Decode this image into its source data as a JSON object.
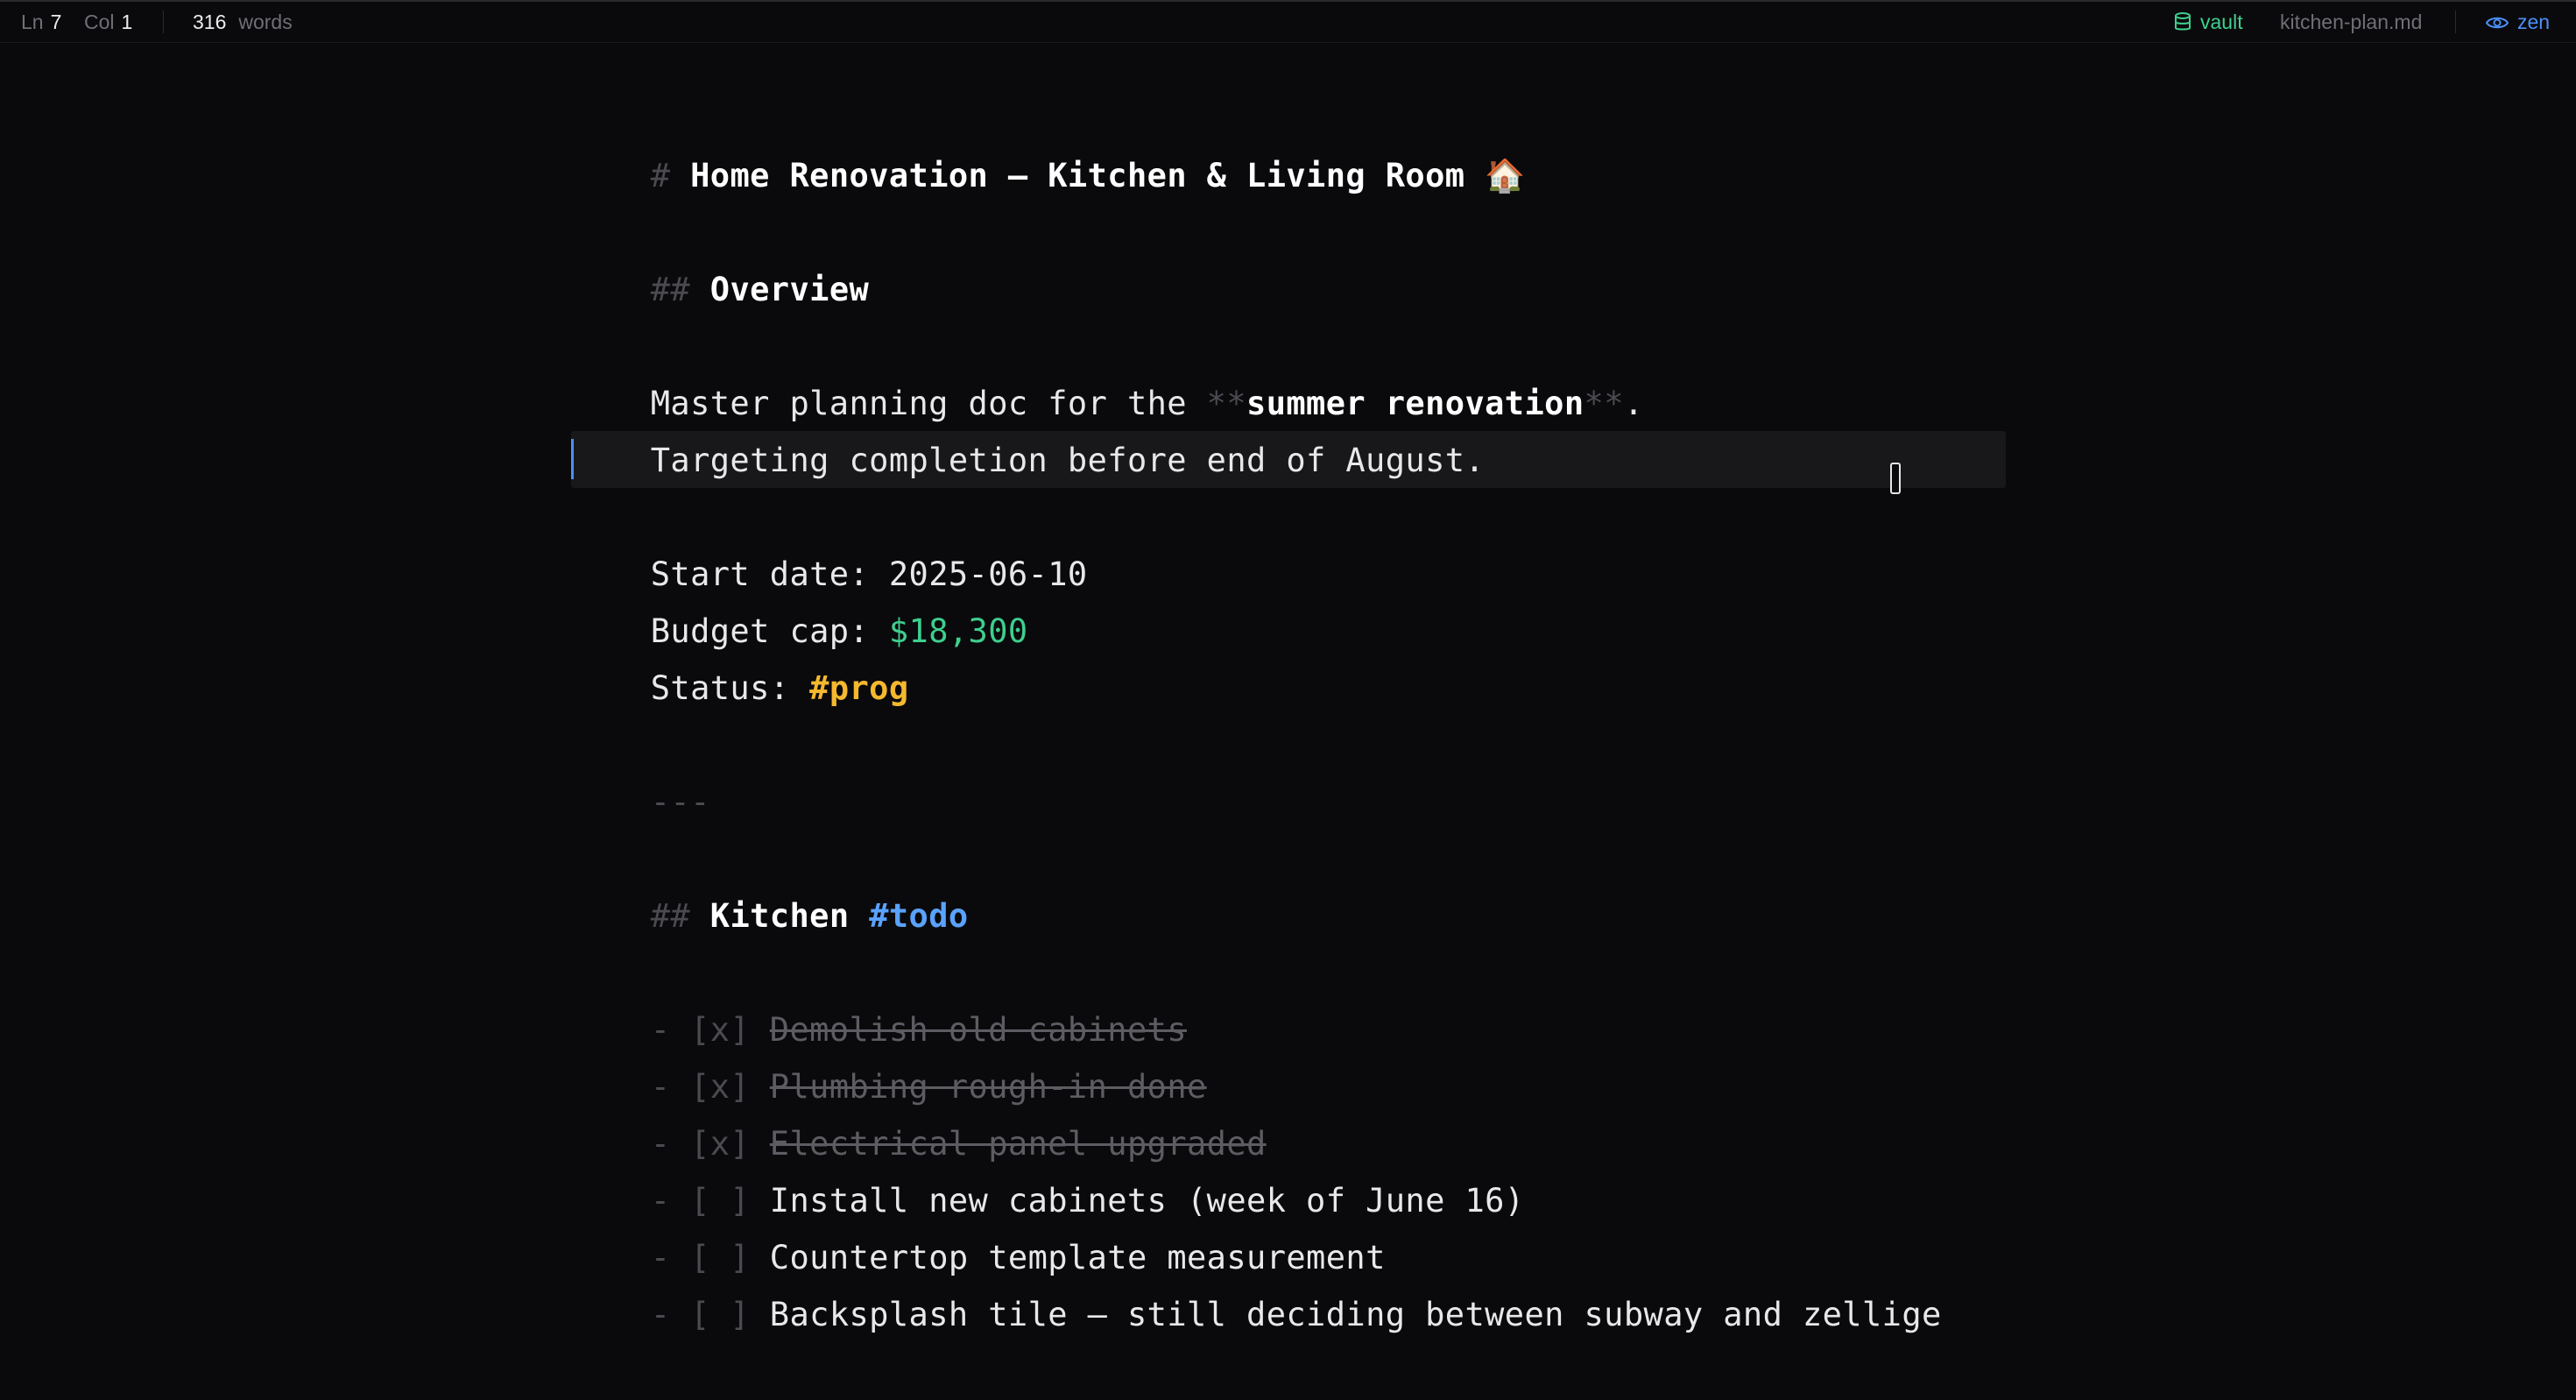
{
  "status_bar": {
    "ln_label": "Ln",
    "ln_value": "7",
    "col_label": "Col",
    "col_value": "1",
    "word_count": "316",
    "words_label": "words",
    "vault_label": "vault",
    "filename": "kitchen-plan.md",
    "zen_label": "zen"
  },
  "document": {
    "h1_marker": "#",
    "title": "Home Renovation — Kitchen & Living Room 🏠",
    "h2_marker": "##",
    "overview_heading": "Overview",
    "overview_text_before": "Master planning doc for the ",
    "bold_marker": "**",
    "overview_bold": "summer renovation",
    "overview_text_after": ".",
    "overview_line2": "Targeting completion before end of August.",
    "start_date_label": "Start date: ",
    "start_date_value": "2025-06-10",
    "budget_label": "Budget cap: ",
    "budget_value": "$18,300",
    "status_label": "Status: ",
    "status_tag": "#prog",
    "hr": "---",
    "kitchen_heading": "Kitchen",
    "kitchen_tag": "#todo",
    "tasks": [
      {
        "marker": "- [x]",
        "text": "Demolish old cabinets",
        "done": true
      },
      {
        "marker": "- [x]",
        "text": "Plumbing rough-in done",
        "done": true
      },
      {
        "marker": "- [x]",
        "text": "Electrical panel upgraded",
        "done": true
      },
      {
        "marker": "- [ ]",
        "text": "Install new cabinets (week of June 16)",
        "done": false
      },
      {
        "marker": "- [ ]",
        "text": "Countertop template measurement",
        "done": false
      },
      {
        "marker": "- [ ]",
        "text": "Backsplash tile — still deciding between subway and zellige",
        "done": false
      }
    ]
  },
  "colors": {
    "background": "#0a0a0c",
    "accent_green": "#3ecf8e",
    "accent_blue": "#4c8ff7",
    "tag_orange": "#f5b82e",
    "tag_blue": "#5aa2ff"
  }
}
